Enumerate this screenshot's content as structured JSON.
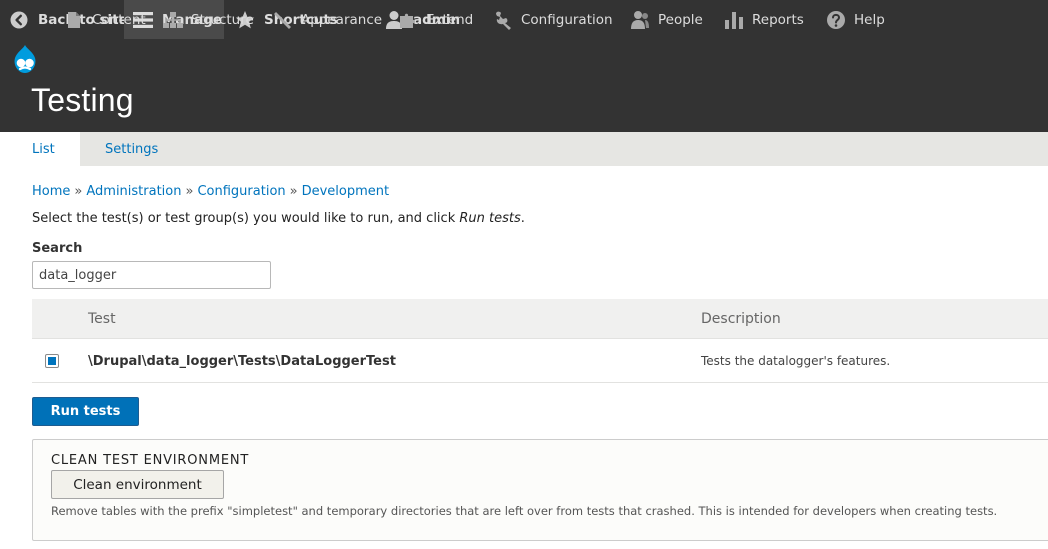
{
  "toolbar": {
    "back_label": "Back to site",
    "manage_label": "Manage",
    "shortcuts_label": "Shortcuts",
    "user_label": "admin"
  },
  "tray": {
    "items": [
      {
        "label": "Content",
        "icon": "file-icon"
      },
      {
        "label": "Structure",
        "icon": "structure-icon"
      },
      {
        "label": "Appearance",
        "icon": "paintbrush-icon"
      },
      {
        "label": "Extend",
        "icon": "puzzle-icon"
      },
      {
        "label": "Configuration",
        "icon": "wrench-icon"
      },
      {
        "label": "People",
        "icon": "people-icon"
      },
      {
        "label": "Reports",
        "icon": "bar-chart-icon"
      },
      {
        "label": "Help",
        "icon": "help-icon"
      }
    ]
  },
  "page": {
    "title": "Testing"
  },
  "tabs": [
    {
      "label": "List",
      "active": true
    },
    {
      "label": "Settings",
      "active": false
    }
  ],
  "breadcrumb": [
    "Home",
    "Administration",
    "Configuration",
    "Development"
  ],
  "breadcrumb_separator": "»",
  "intro": {
    "text": "Select the test(s) or test group(s) you would like to run, and click ",
    "emphasis": "Run tests",
    "suffix": "."
  },
  "search": {
    "label": "Search",
    "value": "data_logger"
  },
  "table": {
    "headers": {
      "test": "Test",
      "description": "Description"
    },
    "rows": [
      {
        "checked": true,
        "test": "\\Drupal\\data_logger\\Tests\\DataLoggerTest",
        "description": "Tests the datalogger's features."
      }
    ]
  },
  "run_button": "Run tests",
  "clean": {
    "legend": "CLEAN TEST ENVIRONMENT",
    "button": "Clean environment",
    "description": "Remove tables with the prefix \"simpletest\" and temporary directories that are left over from tests that crashed. This is intended for developers when creating tests."
  },
  "colors": {
    "toolbar_bg": "#333333",
    "link": "#0074bd",
    "primary_button": "#0071b8",
    "drupal_blue": "#009cde"
  }
}
